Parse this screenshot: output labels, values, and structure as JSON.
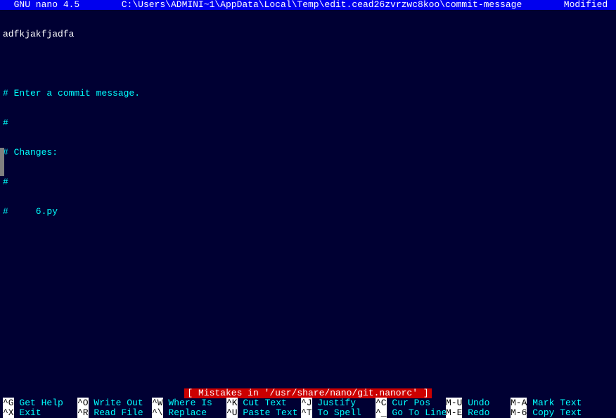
{
  "titlebar": {
    "app": "  GNU nano 4.5",
    "file": "C:\\Users\\ADMINI~1\\AppData\\Local\\Temp\\edit.cead26zvrzwc8koo\\commit-message",
    "status": "Modified "
  },
  "content": {
    "line1": "adfkjakfjadfa",
    "line2": "",
    "line3": "# Enter a commit message.",
    "line4": "#",
    "line5": "# Changes:",
    "line6": "#",
    "line7": "#     6.py"
  },
  "status_message": "[ Mistakes in '/usr/share/nano/git.nanorc' ]",
  "shortcuts": {
    "row1": [
      {
        "key": "^G",
        "desc": " Get Help"
      },
      {
        "key": "^O",
        "desc": " Write Out"
      },
      {
        "key": "^W",
        "desc": " Where Is"
      },
      {
        "key": "^K",
        "desc": " Cut Text"
      },
      {
        "key": "^J",
        "desc": " Justify"
      },
      {
        "key": "^C",
        "desc": " Cur Pos"
      },
      {
        "key": "M-U",
        "desc": " Undo"
      },
      {
        "key": "M-A",
        "desc": " Mark Text"
      }
    ],
    "row2": [
      {
        "key": "^X",
        "desc": " Exit"
      },
      {
        "key": "^R",
        "desc": " Read File"
      },
      {
        "key": "^\\",
        "desc": " Replace"
      },
      {
        "key": "^U",
        "desc": " Paste Text"
      },
      {
        "key": "^T",
        "desc": " To Spell"
      },
      {
        "key": "^_",
        "desc": " Go To Line"
      },
      {
        "key": "M-E",
        "desc": " Redo"
      },
      {
        "key": "M-6",
        "desc": " Copy Text"
      }
    ]
  }
}
